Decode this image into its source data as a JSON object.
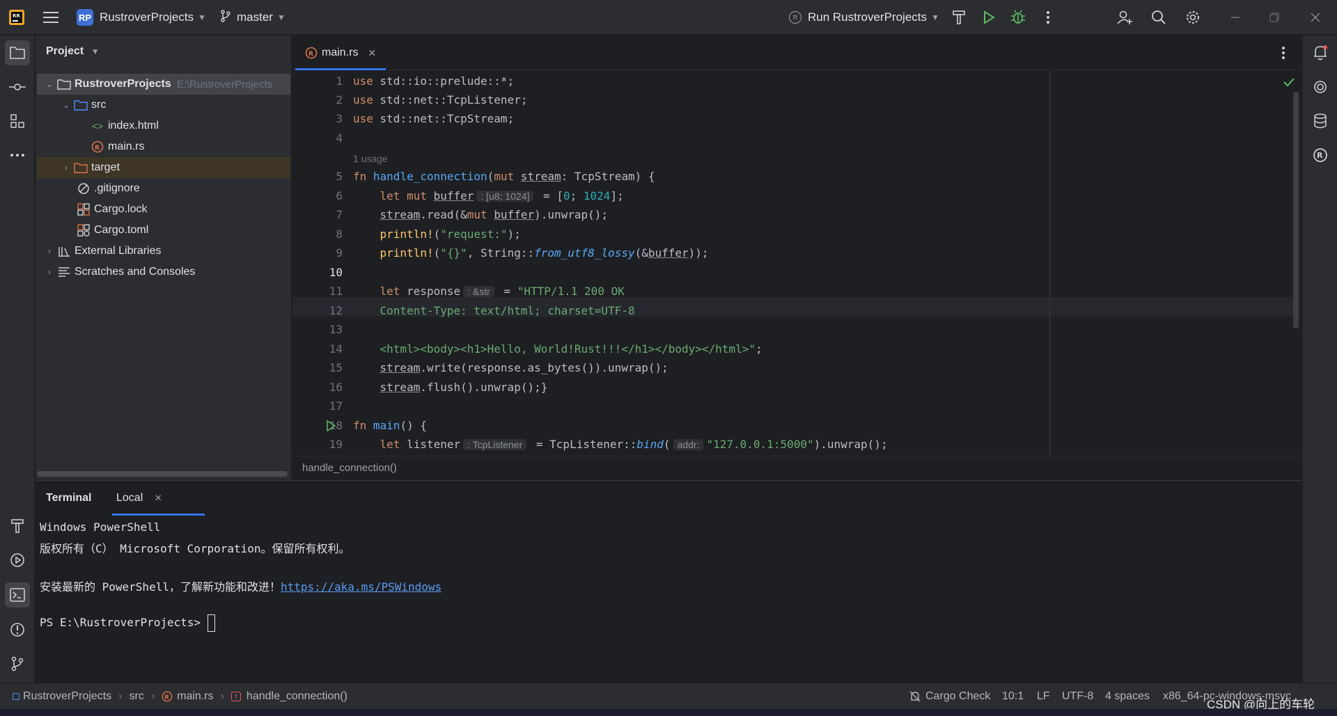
{
  "titlebar": {
    "project_badge": "RP",
    "project_name": "RustroverProjects",
    "branch": "master",
    "run_config": "Run RustroverProjects"
  },
  "project_panel": {
    "header": "Project",
    "tree": [
      {
        "label": "RustroverProjects",
        "hint": "E:\\RustroverProjects"
      },
      {
        "label": "src"
      },
      {
        "label": "index.html"
      },
      {
        "label": "main.rs"
      },
      {
        "label": "target"
      },
      {
        "label": ".gitignore"
      },
      {
        "label": "Cargo.lock"
      },
      {
        "label": "Cargo.toml"
      },
      {
        "label": "External Libraries"
      },
      {
        "label": "Scratches and Consoles"
      }
    ]
  },
  "editor": {
    "tab_label": "main.rs",
    "usage_hint": "1 usage",
    "line_numbers": [
      "1",
      "2",
      "3",
      "4",
      "5",
      "6",
      "7",
      "8",
      "9",
      "10",
      "11",
      "12",
      "13",
      "14",
      "15",
      "16",
      "17",
      "18",
      "19"
    ],
    "current_line": "10",
    "inlay_hints": {
      "buffer_type": ": [u8; 1024]",
      "response_type": ": &str",
      "listener_type": ": TcpListener",
      "addr_param": "addr:"
    },
    "breadcrumb": "handle_connection()"
  },
  "terminal": {
    "title": "Terminal",
    "tab_local": "Local",
    "lines": [
      "Windows PowerShell",
      "版权所有（C） Microsoft Corporation。保留所有权利。",
      "",
      "安装最新的 PowerShell，了解新功能和改进！",
      "",
      "PS E:\\RustroverProjects> "
    ],
    "link": "https://aka.ms/PSWindows"
  },
  "statusbar": {
    "crumbs": [
      "RustroverProjects",
      "src",
      "main.rs",
      "handle_connection()"
    ],
    "cargo_check": "Cargo Check",
    "position": "10:1",
    "line_ending": "LF",
    "encoding": "UTF-8",
    "indent": "4 spaces",
    "target": "x86_64-pc-windows-msvc"
  },
  "watermark": "CSDN @向上的车轮",
  "colors": {
    "accent": "#3574f0",
    "run_green": "#5fb865",
    "badge_blue": "#3f6fd8",
    "rust_orange": "#d9734b"
  }
}
